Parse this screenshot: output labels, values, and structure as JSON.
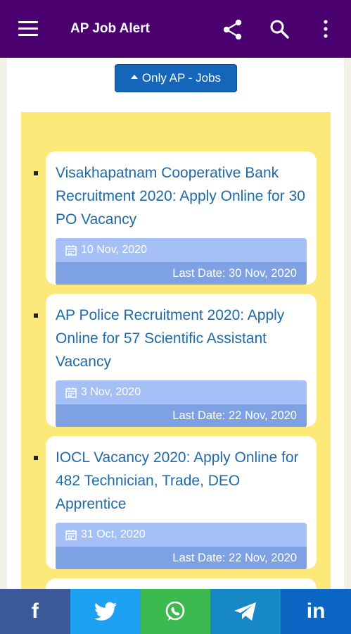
{
  "app": {
    "title": "AP Job Alert"
  },
  "icons": {
    "menu": "hamburger-menu-icon",
    "share": "share-icon",
    "search": "search-icon",
    "more": "more-vert-icon",
    "calendar": "calendar-icon"
  },
  "filter": {
    "label": "Only AP - Jobs"
  },
  "jobs": [
    {
      "title": "Visakhapatnam Cooperative Bank Recruitment 2020: Apply Online for 30 PO Vacancy",
      "date": "10 Nov, 2020",
      "last_date": "Last Date: 30 Nov, 2020"
    },
    {
      "title": "AP Police Recruitment 2020: Apply Online for 57 Scientific Assistant Vacancy",
      "date": "3 Nov, 2020",
      "last_date": "Last Date: 22 Nov, 2020"
    },
    {
      "title": "IOCL Vacancy 2020: Apply Online for 482 Technician, Trade, DEO Apprentice",
      "date": "31 Oct, 2020",
      "last_date": "Last Date: 22 Nov, 2020"
    }
  ],
  "share_bar": [
    {
      "name": "facebook",
      "color": "#3b5998",
      "label": "f"
    },
    {
      "name": "twitter",
      "color": "#1da1f2"
    },
    {
      "name": "whatsapp",
      "color": "#3cb94f"
    },
    {
      "name": "telegram",
      "color": "#1788c6"
    },
    {
      "name": "linkedin",
      "color": "#0a66c2",
      "label": "in"
    }
  ],
  "colors": {
    "appbar": "#4b0070",
    "panel": "#fde97a",
    "link": "#1e6aa8",
    "button": "#1565b8"
  }
}
